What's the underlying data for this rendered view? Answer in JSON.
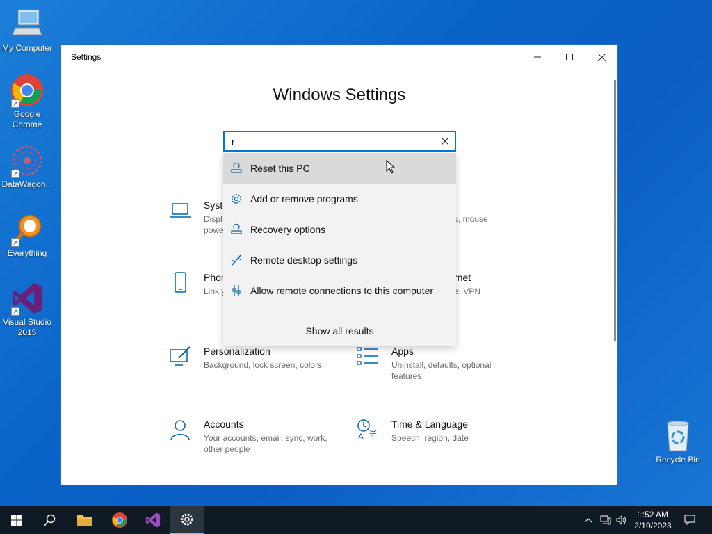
{
  "desktop": {
    "icons": [
      {
        "label": "My Computer"
      },
      {
        "label": "Google Chrome"
      },
      {
        "label": "DataWagon..."
      },
      {
        "label": "Everything"
      },
      {
        "label": "Visual Studio 2015"
      },
      {
        "label": "Recycle Bin"
      }
    ]
  },
  "window": {
    "title": "Settings",
    "heading": "Windows Settings",
    "search": {
      "value": "r"
    },
    "categories": [
      {
        "name": "Syste",
        "desc": "Displ\npowe"
      },
      {
        "name": "",
        "desc": "s, mouse"
      },
      {
        "name": "Phon",
        "desc": "Link y"
      },
      {
        "name": "rnet",
        "desc": "e, VPN"
      },
      {
        "name": "Personalization",
        "desc": "Background, lock screen, colors"
      },
      {
        "name": "Apps",
        "desc": "Uninstall, defaults, optional features"
      },
      {
        "name": "Accounts",
        "desc": "Your accounts, email, sync, work, other people"
      },
      {
        "name": "Time & Language",
        "desc": "Speech, region, date"
      }
    ],
    "dropdown": {
      "items": [
        {
          "label": "Reset this PC",
          "icon": "reset-pc-icon"
        },
        {
          "label": "Add or remove programs",
          "icon": "gear-icon"
        },
        {
          "label": "Recovery options",
          "icon": "recovery-icon"
        },
        {
          "label": "Remote desktop settings",
          "icon": "remote-desktop-icon"
        },
        {
          "label": "Allow remote connections to this computer",
          "icon": "remote-connection-icon"
        }
      ],
      "show_all": "Show all results"
    }
  },
  "taskbar": {
    "apps": [
      "start-icon",
      "search-icon",
      "file-explorer-icon",
      "chrome-icon",
      "visual-studio-icon",
      "settings-icon"
    ],
    "clock": {
      "time": "1:52 AM",
      "date": "2/10/2023"
    }
  },
  "colors": {
    "accent": "#0078d7",
    "desktop": "#0b63c8",
    "taskbar": "#101a24"
  }
}
